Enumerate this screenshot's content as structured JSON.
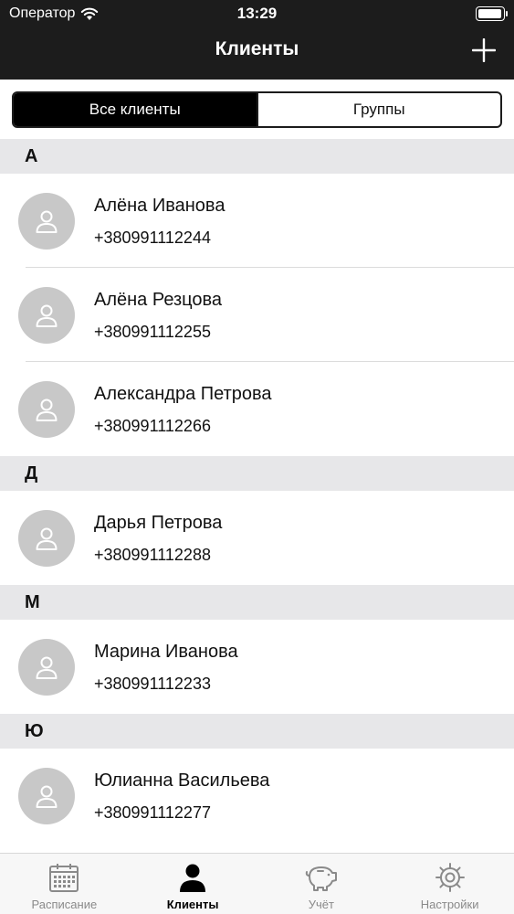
{
  "status_bar": {
    "carrier": "Оператор",
    "time": "13:29"
  },
  "nav": {
    "title": "Клиенты"
  },
  "segments": {
    "all_clients": "Все клиенты",
    "groups": "Группы"
  },
  "sections": [
    {
      "letter": "А",
      "clients": [
        {
          "name": "Алёна Иванова",
          "phone": "+380991112244"
        },
        {
          "name": "Алёна Резцова",
          "phone": "+380991112255"
        },
        {
          "name": "Александра Петрова",
          "phone": "+380991112266"
        }
      ]
    },
    {
      "letter": "Д",
      "clients": [
        {
          "name": "Дарья Петрова",
          "phone": "+380991112288"
        }
      ]
    },
    {
      "letter": "М",
      "clients": [
        {
          "name": "Марина Иванова",
          "phone": "+380991112233"
        }
      ]
    },
    {
      "letter": "Ю",
      "clients": [
        {
          "name": "Юлианна Васильева",
          "phone": "+380991112277"
        }
      ]
    }
  ],
  "tabbar": {
    "schedule": "Расписание",
    "clients": "Клиенты",
    "accounting": "Учёт",
    "settings": "Настройки"
  },
  "colors": {
    "header_bg": "#1c1c1c",
    "section_bg": "#e7e7e9",
    "avatar_bg": "#c8c8c8",
    "tabbar_bg": "#f7f7f7"
  },
  "icons": [
    "wifi-icon",
    "battery-icon",
    "plus-icon",
    "person-icon",
    "calendar-icon",
    "person-filled-icon",
    "piggy-bank-icon",
    "gear-icon"
  ]
}
